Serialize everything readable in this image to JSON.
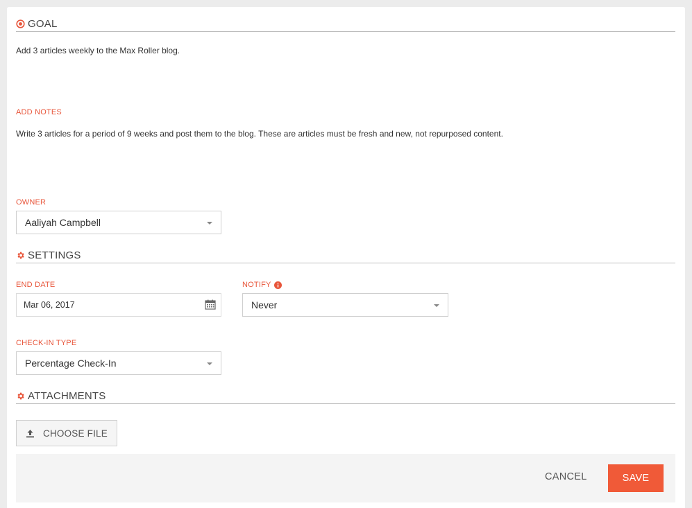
{
  "goal": {
    "heading": "GOAL",
    "text": "Add 3 articles weekly to the Max Roller blog."
  },
  "notes": {
    "label": "ADD NOTES",
    "text": "Write 3 articles for a period of 9 weeks and post them to the blog. These are articles must be fresh and new, not repurposed content."
  },
  "owner": {
    "label": "OWNER",
    "value": "Aaliyah Campbell"
  },
  "settings": {
    "heading": "SETTINGS",
    "end_date": {
      "label": "END DATE",
      "value": "Mar 06, 2017"
    },
    "notify": {
      "label": "NOTIFY",
      "value": "Never"
    },
    "checkin_type": {
      "label": "CHECK-IN TYPE",
      "value": "Percentage Check-In"
    }
  },
  "attachments": {
    "heading": "ATTACHMENTS",
    "choose_file_label": "CHOOSE FILE"
  },
  "footer": {
    "cancel_label": "CANCEL",
    "save_label": "SAVE"
  },
  "colors": {
    "accent": "#e8553a",
    "save_button": "#f05a38"
  },
  "icons": {
    "goal": "target-icon",
    "settings": "gear-icon",
    "attachments": "gear-icon",
    "notify_info": "info-icon",
    "date": "calendar-icon",
    "upload": "upload-icon"
  }
}
